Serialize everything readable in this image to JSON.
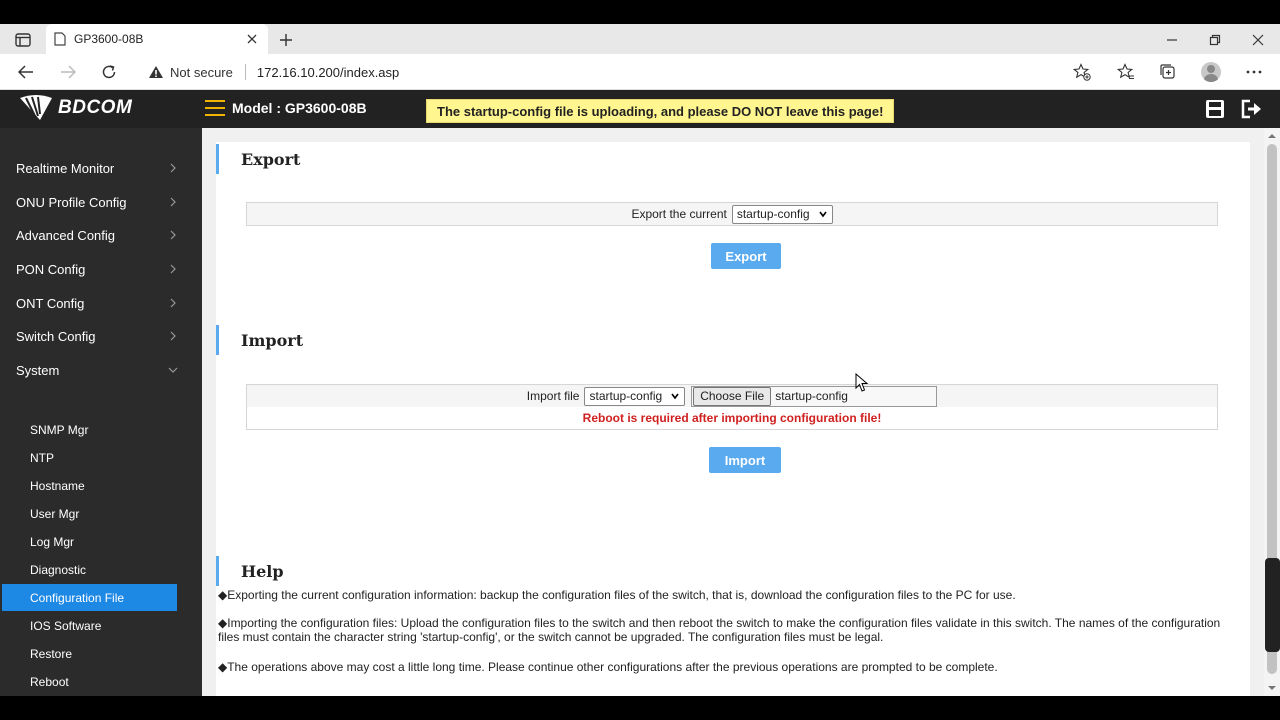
{
  "browser": {
    "tab_title": "GP3600-08B",
    "security_label": "Not secure",
    "url": "172.16.10.200/index.asp"
  },
  "header": {
    "brand": "BDCOM",
    "model": "Model : GP3600-08B",
    "notice": "The startup-config file is uploading, and please DO NOT leave this page!",
    "accent_color": "#f0b400",
    "notice_color": "#fff68f"
  },
  "sidebar": {
    "items": [
      {
        "label": "Realtime Monitor",
        "expanded": false
      },
      {
        "label": "ONU Profile Config",
        "expanded": false
      },
      {
        "label": "Advanced Config",
        "expanded": false
      },
      {
        "label": "PON Config",
        "expanded": false
      },
      {
        "label": "ONT Config",
        "expanded": false
      },
      {
        "label": "Switch Config",
        "expanded": false
      },
      {
        "label": "System",
        "expanded": true
      }
    ],
    "subitems": [
      {
        "label": "SNMP Mgr"
      },
      {
        "label": "NTP"
      },
      {
        "label": "Hostname"
      },
      {
        "label": "User Mgr"
      },
      {
        "label": "Log Mgr"
      },
      {
        "label": "Diagnostic"
      },
      {
        "label": "Configuration File",
        "active": true
      },
      {
        "label": "IOS Software"
      },
      {
        "label": "Restore"
      },
      {
        "label": "Reboot"
      }
    ],
    "active_color": "#1e88e5"
  },
  "export": {
    "title": "Export",
    "label": "Export the current",
    "selected": "startup-config",
    "button": "Export"
  },
  "import": {
    "title": "Import",
    "label": "Import file",
    "selected": "startup-config",
    "choose_button": "Choose File",
    "file_name": "startup-config",
    "warning": "Reboot is required after importing configuration file!",
    "button": "Import"
  },
  "help": {
    "title": "Help",
    "lines": [
      "◆Exporting the current configuration information: backup the configuration files of the switch, that is, download the configuration files to the PC for use.",
      "◆Importing the configuration files: Upload the configuration files to the switch and then reboot the switch to make the configuration files validate in this switch. The names of the configuration files must contain the character string 'startup-config', or the switch cannot be upgraded. The configuration files must be legal.",
      "◆The operations above may cost a little long time. Please continue other configurations after the previous operations are prompted to be complete."
    ]
  },
  "button_color": "#5aaaf0"
}
